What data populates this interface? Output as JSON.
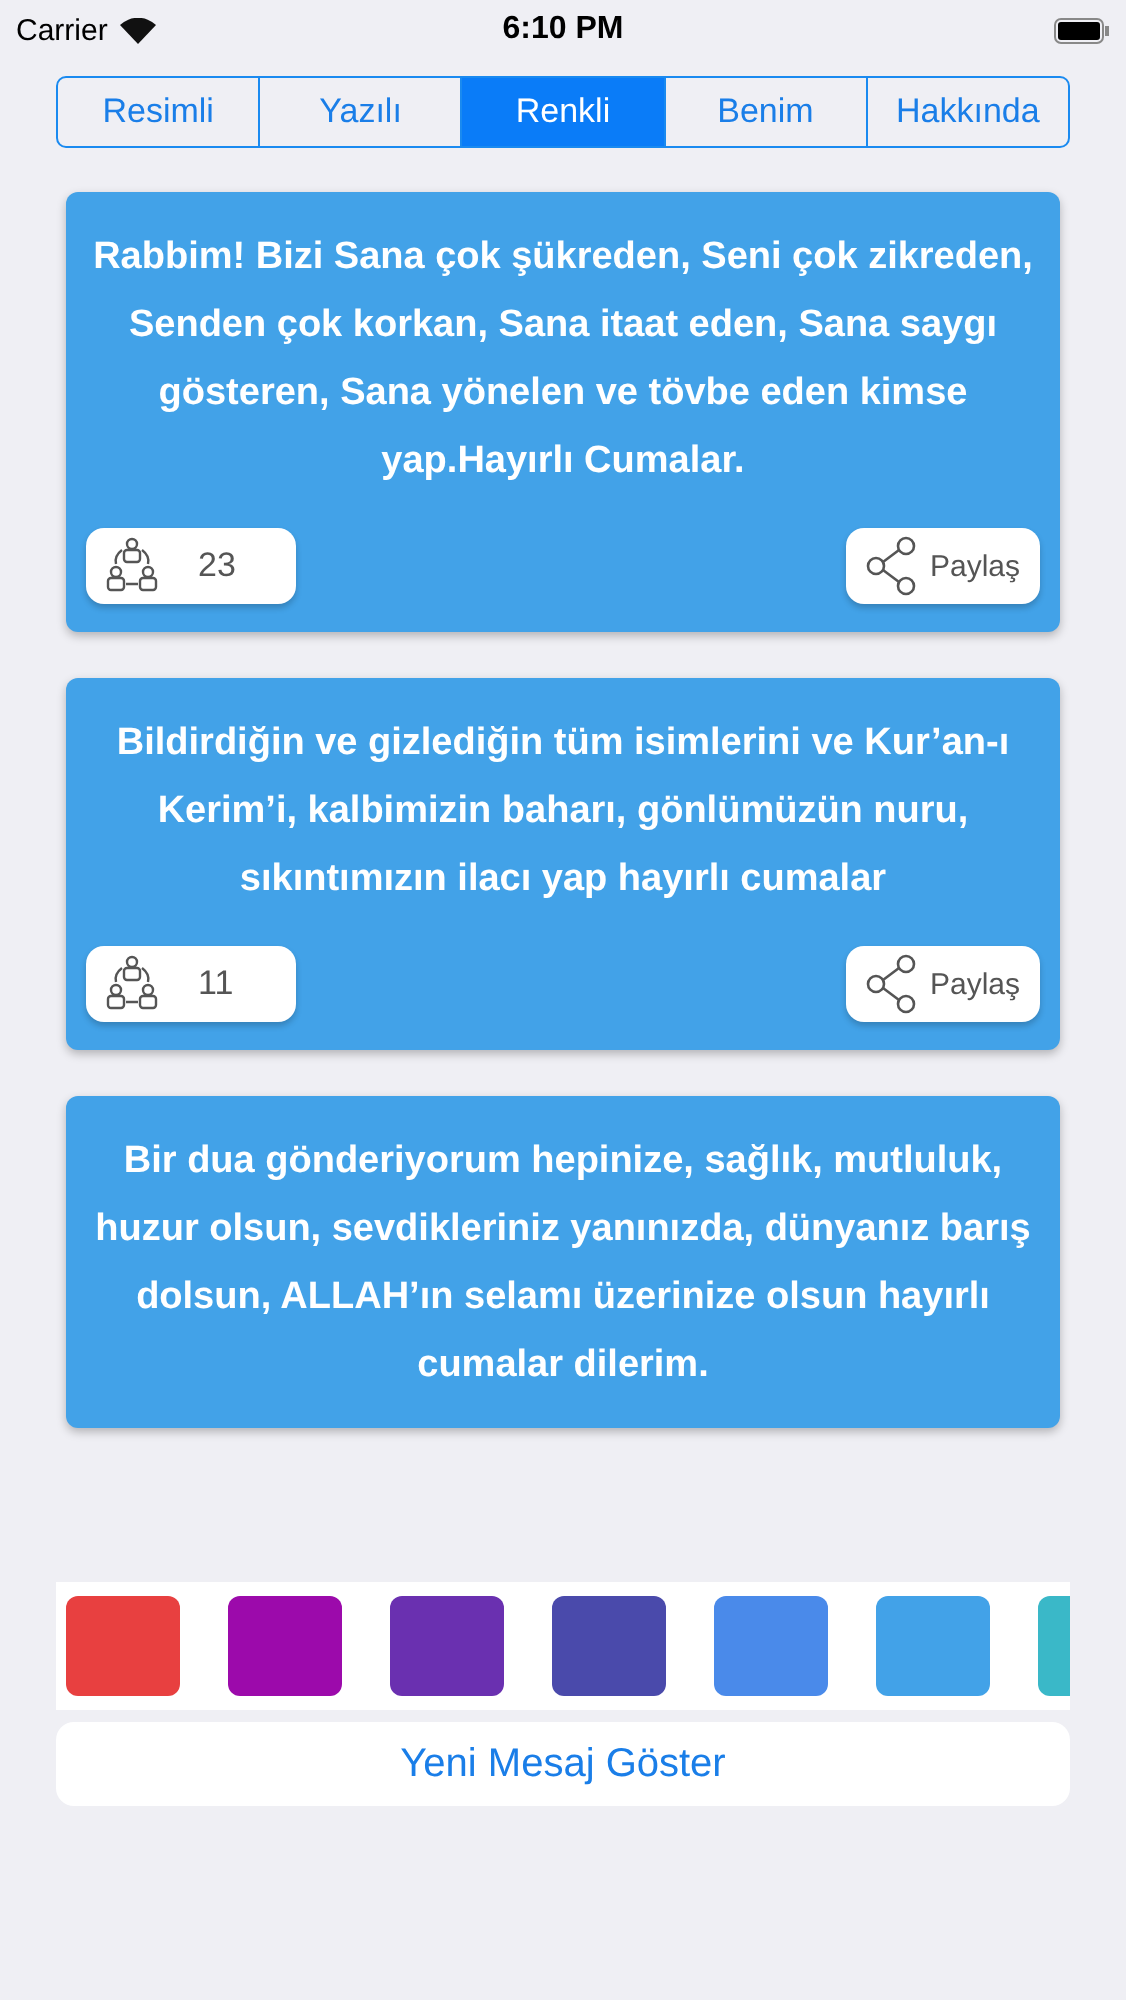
{
  "status_bar": {
    "carrier": "Carrier",
    "time": "6:10 PM"
  },
  "tabs": [
    {
      "label": "Resimli",
      "selected": false
    },
    {
      "label": "Yazılı",
      "selected": false
    },
    {
      "label": "Renkli",
      "selected": true
    },
    {
      "label": "Benim",
      "selected": false
    },
    {
      "label": "Hakkında",
      "selected": false
    }
  ],
  "cards": [
    {
      "text": "Rabbim! Bizi Sana çok şükreden, Seni çok zikreden, Senden çok korkan, Sana itaat eden, Sana saygı gösteren, Sana yönelen ve tövbe eden kimse yap.Hayırlı Cumalar.",
      "count": "23",
      "share": "Paylaş"
    },
    {
      "text": "Bildirdiğin ve gizlediğin tüm isimlerini ve Kur’an-ı Kerim’i, kalbimizin baharı, gönlümüzün nuru, sıkıntımızın ilacı yap hayırlı cumalar",
      "count": "11",
      "share": "Paylaş"
    },
    {
      "text": "Bir dua gönderiyorum hepinize, sağlık, mutluluk, huzur olsun, sevdikleriniz yanınızda, dünyanız barış dolsun, ALLAH’ın selamı üzerinize olsun hayırlı cumalar dilerim."
    }
  ],
  "palette": [
    {
      "color": "#e84040"
    },
    {
      "color": "#9c0aab"
    },
    {
      "color": "#6a30b0"
    },
    {
      "color": "#4a4aab"
    },
    {
      "color": "#4a8aea"
    },
    {
      "color": "#42a2e8"
    },
    {
      "color": "#3ab8c8"
    }
  ],
  "button": "Yeni Mesaj Göster"
}
